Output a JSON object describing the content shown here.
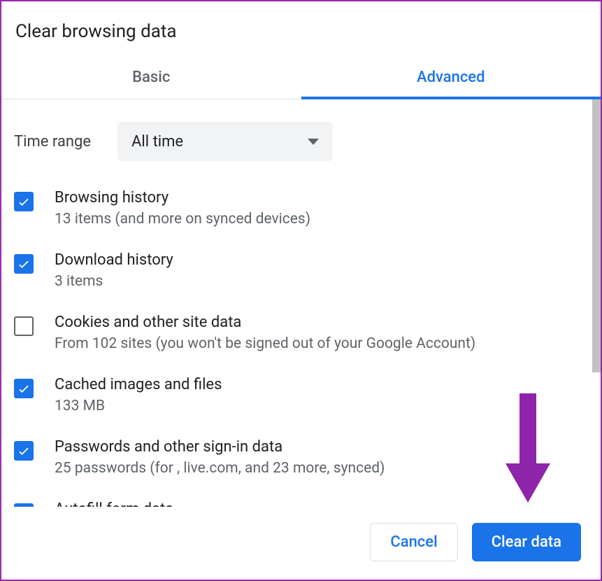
{
  "title": "Clear browsing data",
  "tabs": {
    "basic": "Basic",
    "advanced": "Advanced"
  },
  "time_range": {
    "label": "Time range",
    "value": "All time"
  },
  "items": [
    {
      "title": "Browsing history",
      "sub": "13 items (and more on synced devices)",
      "checked": true
    },
    {
      "title": "Download history",
      "sub": "3 items",
      "checked": true
    },
    {
      "title": "Cookies and other site data",
      "sub": "From 102 sites (you won't be signed out of your Google Account)",
      "checked": false
    },
    {
      "title": "Cached images and files",
      "sub": "133 MB",
      "checked": true
    },
    {
      "title": "Passwords and other sign-in data",
      "sub": "25 passwords (for , live.com, and 23 more, synced)",
      "checked": true
    },
    {
      "title": "Autofill form data",
      "sub": "",
      "checked": true
    }
  ],
  "buttons": {
    "cancel": "Cancel",
    "clear": "Clear data"
  }
}
